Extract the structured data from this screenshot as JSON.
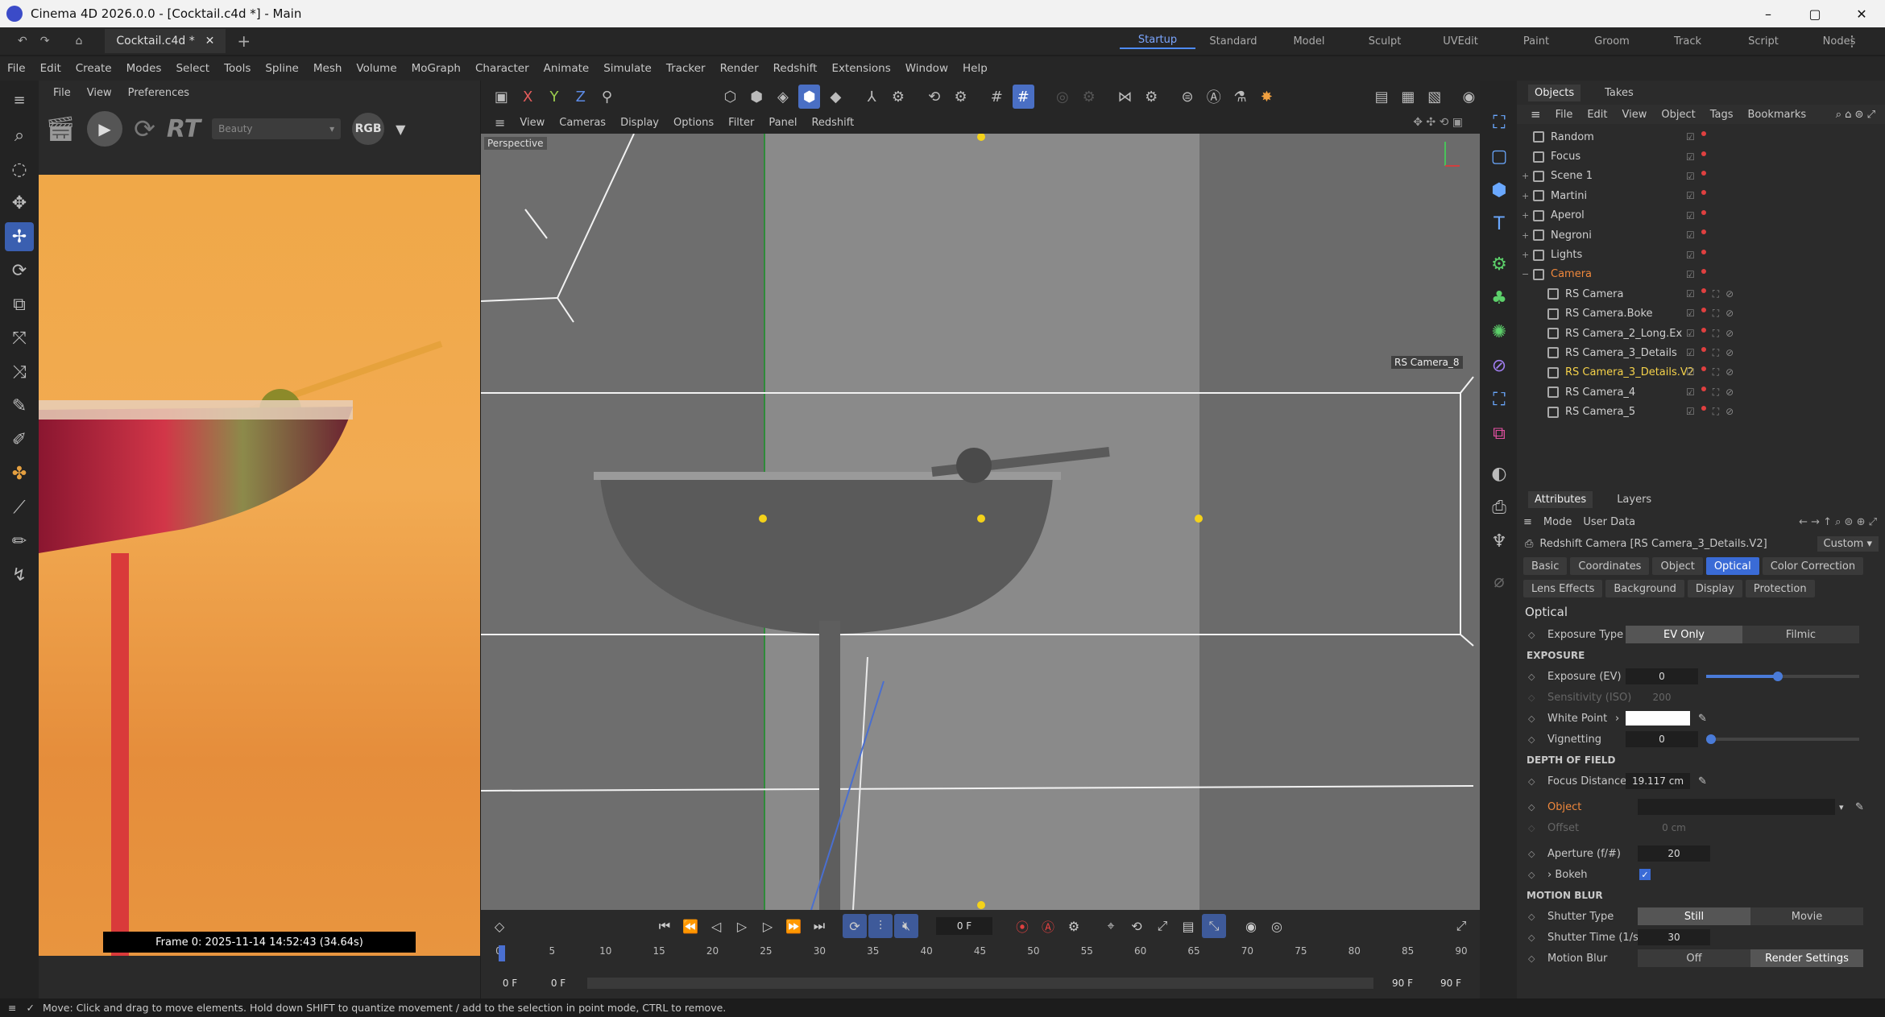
{
  "window": {
    "title": "Cinema 4D 2026.0.0 - [Cocktail.c4d *] - Main",
    "min": "–",
    "max": "▢",
    "close": "✕"
  },
  "tabbar": {
    "doc_tab": "Cocktail.c4d *",
    "close": "✕",
    "add": "+",
    "layouts": [
      "Startup",
      "Standard",
      "Model",
      "Sculpt",
      "UVEdit",
      "Paint",
      "Groom",
      "Track",
      "Script",
      "Nodes"
    ],
    "active_layout": "Startup"
  },
  "menu": [
    "File",
    "Edit",
    "Create",
    "Modes",
    "Select",
    "Tools",
    "Spline",
    "Mesh",
    "Volume",
    "MoGraph",
    "Character",
    "Animate",
    "Simulate",
    "Tracker",
    "Render",
    "Redshift",
    "Extensions",
    "Window",
    "Help"
  ],
  "render_view": {
    "menu": [
      "File",
      "View",
      "Preferences"
    ],
    "rt_label": "RT",
    "aov_select": "Beauty",
    "rgb_label": "RGB",
    "frame_info": "Frame  0:  2025-11-14  14:52:43  (34.64s)"
  },
  "viewport": {
    "menu": [
      "View",
      "Cameras",
      "Display",
      "Options",
      "Filter",
      "Panel",
      "Redshift"
    ],
    "view_name": "Perspective",
    "camera_label": "RS Camera_8"
  },
  "timeline": {
    "current_frame": "0 F",
    "ruler_ticks": [
      "0",
      "5",
      "10",
      "15",
      "20",
      "25",
      "30",
      "35",
      "40",
      "45",
      "50",
      "55",
      "60",
      "65",
      "70",
      "75",
      "80",
      "85",
      "90"
    ],
    "start_field_1": "0 F",
    "start_field_2": "0 F",
    "end_field_1": "90 F",
    "end_field_2": "90 F"
  },
  "objects_panel": {
    "tabs": [
      "Objects",
      "Takes"
    ],
    "menu": [
      "File",
      "Edit",
      "View",
      "Object",
      "Tags",
      "Bookmarks"
    ],
    "items": [
      {
        "name": "Random",
        "indent": 0,
        "style": "normal",
        "expand": ""
      },
      {
        "name": "Focus",
        "indent": 0,
        "style": "normal",
        "expand": ""
      },
      {
        "name": "Scene 1",
        "indent": 0,
        "style": "normal",
        "expand": "+"
      },
      {
        "name": "Martini",
        "indent": 0,
        "style": "normal",
        "expand": "+"
      },
      {
        "name": "Aperol",
        "indent": 0,
        "style": "normal",
        "expand": "+"
      },
      {
        "name": "Negroni",
        "indent": 0,
        "style": "normal",
        "expand": "+"
      },
      {
        "name": "Lights",
        "indent": 0,
        "style": "normal",
        "expand": "+"
      },
      {
        "name": "Camera",
        "indent": 0,
        "style": "orange",
        "expand": "−"
      },
      {
        "name": "RS Camera",
        "indent": 1,
        "style": "normal",
        "expand": ""
      },
      {
        "name": "RS Camera.Boke",
        "indent": 1,
        "style": "normal",
        "expand": ""
      },
      {
        "name": "RS Camera_2_Long.Ex",
        "indent": 1,
        "style": "normal",
        "expand": ""
      },
      {
        "name": "RS Camera_3_Details",
        "indent": 1,
        "style": "normal",
        "expand": ""
      },
      {
        "name": "RS Camera_3_Details.V2",
        "indent": 1,
        "style": "yellow",
        "expand": ""
      },
      {
        "name": "RS Camera_4",
        "indent": 1,
        "style": "normal",
        "expand": ""
      },
      {
        "name": "RS Camera_5",
        "indent": 1,
        "style": "normal",
        "expand": ""
      }
    ]
  },
  "attributes_panel": {
    "tabs": [
      "Attributes",
      "Layers"
    ],
    "mode_label": "Mode",
    "user_data_label": "User Data",
    "object_title": "Redshift Camera [RS Camera_3_Details.V2]",
    "preset": "Custom",
    "tab_row1": [
      "Basic",
      "Coordinates",
      "Object",
      "Optical",
      "Color Correction"
    ],
    "tab_row2": [
      "Lens Effects",
      "Background",
      "Display",
      "Protection"
    ],
    "active_tab": "Optical",
    "section_title": "Optical",
    "exposure_type_label": "Exposure Type",
    "exposure_type_options": [
      "EV Only",
      "Filmic"
    ],
    "exposure_head": "EXPOSURE",
    "exposure_ev_label": "Exposure (EV)",
    "exposure_ev_value": "0",
    "sensitivity_label": "Sensitivity (ISO)",
    "sensitivity_value": "200",
    "white_point_label": "White Point",
    "vignetting_label": "Vignetting",
    "vignetting_value": "0",
    "dof_head": "DEPTH OF FIELD",
    "focus_distance_label": "Focus Distance",
    "focus_distance_value": "19.117 cm",
    "object_label": "Object",
    "offset_label": "Offset",
    "offset_value": "0 cm",
    "aperture_label": "Aperture (f/#)",
    "aperture_value": "20",
    "bokeh_label": "Bokeh",
    "motion_blur_head": "MOTION BLUR",
    "shutter_type_label": "Shutter Type",
    "shutter_type_options": [
      "Still",
      "Movie"
    ],
    "shutter_time_label": "Shutter Time (1/s)",
    "shutter_time_value": "30",
    "motion_blur_label": "Motion Blur",
    "motion_blur_options": [
      "Off",
      "Render Settings"
    ]
  },
  "status": {
    "text": "Move: Click and drag to move elements. Hold down SHIFT to quantize movement / add to the selection in point mode, CTRL to remove."
  },
  "colors": {
    "accent": "#4a7bd8",
    "camera_orange": "#f0883c",
    "selected_yellow": "#f5d24a",
    "render_bg": "#f0a848"
  }
}
